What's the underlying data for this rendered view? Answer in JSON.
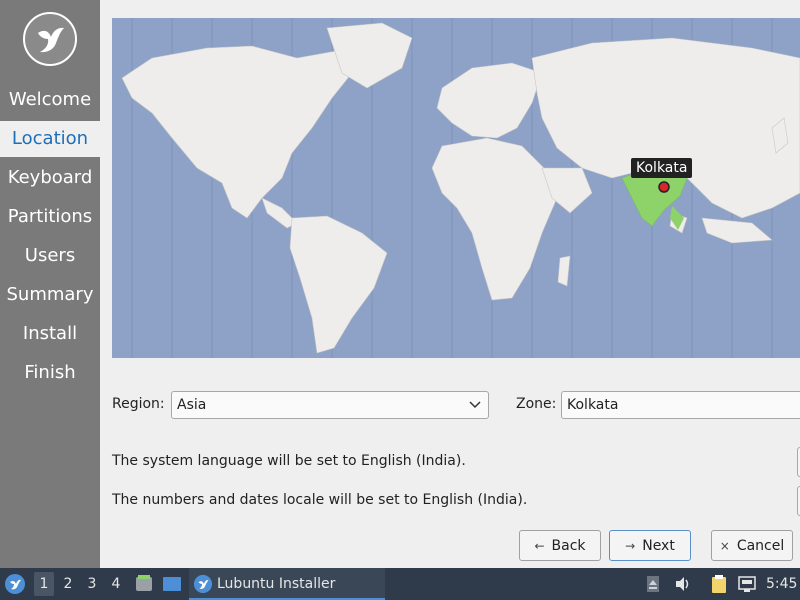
{
  "sidebar": {
    "steps": [
      {
        "label": "Welcome",
        "active": false
      },
      {
        "label": "Location",
        "active": true
      },
      {
        "label": "Keyboard",
        "active": false
      },
      {
        "label": "Partitions",
        "active": false
      },
      {
        "label": "Users",
        "active": false
      },
      {
        "label": "Summary",
        "active": false
      },
      {
        "label": "Install",
        "active": false
      },
      {
        "label": "Finish",
        "active": false
      }
    ],
    "logo_icon": "lubuntu-bird-icon"
  },
  "map": {
    "selected_city": "Kolkata",
    "highlighted_country": "India",
    "ocean_color": "#8da2c6",
    "land_color": "#eeedeb",
    "highlight_color": "#8ed26a"
  },
  "location": {
    "region_label": "Region:",
    "region_value": "Asia",
    "zone_label": "Zone:",
    "zone_value": "Kolkata"
  },
  "locale": {
    "language_text": "The system language will be set to English (India).",
    "numbers_text": "The numbers and dates locale will be set to English (India)."
  },
  "buttons": {
    "back": "Back",
    "next": "Next",
    "cancel": "Cancel"
  },
  "taskbar": {
    "desktops": [
      "1",
      "2",
      "3",
      "4"
    ],
    "active_desktop": "1",
    "app_title": "Lubuntu Installer",
    "clock": "5:45"
  }
}
